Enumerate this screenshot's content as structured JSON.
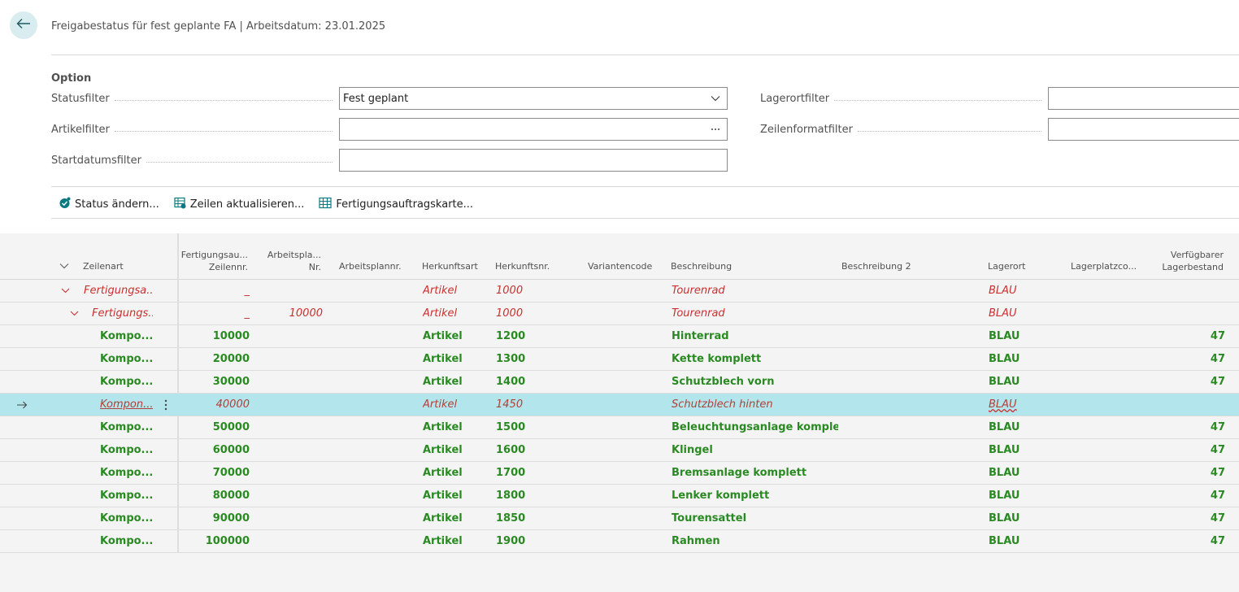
{
  "header": {
    "title": "Freigabestatus für fest geplante FA | Arbeitsdatum: 23.01.2025"
  },
  "options": {
    "section_label": "Option",
    "status_filter": {
      "label": "Statusfilter",
      "value": "Fest geplant"
    },
    "artikel_filter": {
      "label": "Artikelfilter",
      "value": ""
    },
    "startdatum_filter": {
      "label": "Startdatumsfilter",
      "value": ""
    },
    "lagerort_filter": {
      "label": "Lagerortfilter",
      "value": ""
    },
    "zeilenformat_filter": {
      "label": "Zeilenformatfilter",
      "value": ""
    }
  },
  "actions": {
    "status_aendern": "Status ändern...",
    "zeilen_aktualisieren": "Zeilen aktualisieren...",
    "fertigungsauftragskarte": "Fertigungsauftragskarte..."
  },
  "columns": {
    "zeilenart": "Zeilenart",
    "fa_zeilennr_1": "Fertigungsau...",
    "fa_zeilennr_2": "Zeilennr.",
    "arbeitsplan_nr_1": "Arbeitspla...",
    "arbeitsplan_nr_2": "Nr.",
    "arbeitsplannr": "Arbeitsplannr.",
    "herkunftsart": "Herkunftsart",
    "herkunftsnr": "Herkunftsnr.",
    "variantencode": "Variantencode",
    "beschreibung": "Beschreibung",
    "beschreibung2": "Beschreibung 2",
    "lagerort": "Lagerort",
    "lagerplatzcode": "Lagerplatzco...",
    "verfuegbar_1": "Verfügbarer",
    "verfuegbar_2": "Lagerbestand"
  },
  "rows": [
    {
      "kind": "red",
      "level": 0,
      "zeilenart": "Fertigungsa...",
      "zeilennr": "_",
      "arbeitsplan_nr": "",
      "herkunftsart": "Artikel",
      "herkunftsnr": "1000",
      "beschreibung": "Tourenrad",
      "lagerort": "BLAU",
      "bestand": ""
    },
    {
      "kind": "red",
      "level": 1,
      "zeilenart": "Fertigungs...",
      "zeilennr": "_",
      "arbeitsplan_nr": "10000",
      "herkunftsart": "Artikel",
      "herkunftsnr": "1000",
      "beschreibung": "Tourenrad",
      "lagerort": "BLAU",
      "bestand": ""
    },
    {
      "kind": "green",
      "level": 2,
      "zeilenart": "Kompo...",
      "zeilennr": "10000",
      "arbeitsplan_nr": "",
      "herkunftsart": "Artikel",
      "herkunftsnr": "1200",
      "beschreibung": "Hinterrad",
      "lagerort": "BLAU",
      "bestand": "47"
    },
    {
      "kind": "green",
      "level": 2,
      "zeilenart": "Kompo...",
      "zeilennr": "20000",
      "arbeitsplan_nr": "",
      "herkunftsart": "Artikel",
      "herkunftsnr": "1300",
      "beschreibung": "Kette komplett",
      "lagerort": "BLAU",
      "bestand": "47"
    },
    {
      "kind": "green",
      "level": 2,
      "zeilenart": "Kompo...",
      "zeilennr": "30000",
      "arbeitsplan_nr": "",
      "herkunftsart": "Artikel",
      "herkunftsnr": "1400",
      "beschreibung": "Schutzblech vorn",
      "lagerort": "BLAU",
      "bestand": "47"
    },
    {
      "kind": "selected",
      "level": 2,
      "zeilenart": "Kompon...",
      "zeilennr": "40000",
      "arbeitsplan_nr": "",
      "herkunftsart": "Artikel",
      "herkunftsnr": "1450",
      "beschreibung": "Schutzblech hinten",
      "lagerort": "BLAU",
      "bestand": ""
    },
    {
      "kind": "green",
      "level": 2,
      "zeilenart": "Kompo...",
      "zeilennr": "50000",
      "arbeitsplan_nr": "",
      "herkunftsart": "Artikel",
      "herkunftsnr": "1500",
      "beschreibung": "Beleuchtungsanlage komplett",
      "lagerort": "BLAU",
      "bestand": "47"
    },
    {
      "kind": "green",
      "level": 2,
      "zeilenart": "Kompo...",
      "zeilennr": "60000",
      "arbeitsplan_nr": "",
      "herkunftsart": "Artikel",
      "herkunftsnr": "1600",
      "beschreibung": "Klingel",
      "lagerort": "BLAU",
      "bestand": "47"
    },
    {
      "kind": "green",
      "level": 2,
      "zeilenart": "Kompo...",
      "zeilennr": "70000",
      "arbeitsplan_nr": "",
      "herkunftsart": "Artikel",
      "herkunftsnr": "1700",
      "beschreibung": "Bremsanlage komplett",
      "lagerort": "BLAU",
      "bestand": "47"
    },
    {
      "kind": "green",
      "level": 2,
      "zeilenart": "Kompo...",
      "zeilennr": "80000",
      "arbeitsplan_nr": "",
      "herkunftsart": "Artikel",
      "herkunftsnr": "1800",
      "beschreibung": "Lenker komplett",
      "lagerort": "BLAU",
      "bestand": "47"
    },
    {
      "kind": "green",
      "level": 2,
      "zeilenart": "Kompo...",
      "zeilennr": "90000",
      "arbeitsplan_nr": "",
      "herkunftsart": "Artikel",
      "herkunftsnr": "1850",
      "beschreibung": "Tourensattel",
      "lagerort": "BLAU",
      "bestand": "47"
    },
    {
      "kind": "green",
      "level": 2,
      "zeilenart": "Kompo...",
      "zeilennr": "100000",
      "arbeitsplan_nr": "",
      "herkunftsart": "Artikel",
      "herkunftsnr": "1900",
      "beschreibung": "Rahmen",
      "lagerort": "BLAU",
      "bestand": "47"
    }
  ],
  "icons": {
    "back": "back-arrow-icon",
    "dropdown": "chevron-down-icon",
    "lookup": "ellipsis-icon",
    "status": "status-change-icon",
    "refresh": "refresh-lines-icon",
    "card": "card-icon",
    "selected_row": "row-arrow-icon",
    "row_menu": "kebab-menu-icon"
  },
  "colors": {
    "red_line": "#c8312f",
    "green_line": "#2a8a22",
    "selected_row_bg": "#b3e6ec",
    "accent": "#0a7a82"
  }
}
